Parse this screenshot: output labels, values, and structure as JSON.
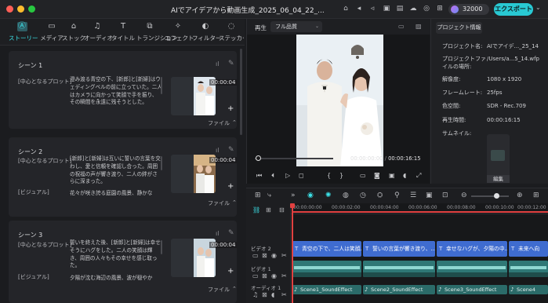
{
  "window": {
    "title": "AIでアイデアから動画生成_2025_06_04_22_..."
  },
  "header": {
    "credits": "32000",
    "export_label": "エクスポート",
    "icons": [
      "gift-icon",
      "paper-plane-icon",
      "megaphone-icon",
      "image-icon",
      "save-icon",
      "cloud-upload-icon",
      "headset-icon",
      "grid-icon"
    ]
  },
  "colors": {
    "accent": "#29c9d3",
    "text_clip": "#3f6cd0",
    "video_clip": "#2f7876",
    "playhead": "#e04040",
    "background": "#1b1c1f"
  },
  "media_toolbar": {
    "items": [
      {
        "label": "ストーリー",
        "icon": "ai-story-icon",
        "active": true
      },
      {
        "label": "メディア",
        "icon": "media-icon"
      },
      {
        "label": "ストック",
        "icon": "stock-icon"
      },
      {
        "label": "オーディオ",
        "icon": "music-note-icon"
      },
      {
        "label": "タイトル",
        "icon": "title-t-icon"
      },
      {
        "label": "トランジション",
        "icon": "transition-icon"
      },
      {
        "label": "エフェクト",
        "icon": "effect-icon"
      },
      {
        "label": "フィルター",
        "icon": "filter-icon"
      },
      {
        "label": "ステッカー",
        "icon": "sticker-icon"
      }
    ]
  },
  "scenes": [
    {
      "title": "シーン 1",
      "plot_label": "[中心となるプロット]",
      "plot_text": "澄み渡る青空の下、[新郎]と[新婦]はウェディングベルの前に立っていた。二人はカメラに向かって笑顔で手を振り、その瞬間を永遠に残そうとした。",
      "duration": "00:00:04",
      "file_label": "ファイル"
    },
    {
      "title": "シーン 2",
      "plot_label": "[中心となるプロット]",
      "plot_text": "[新郎]と[新婦]は互いに誓いの言葉を交わし、愛と信頼を確認し合った。周囲の祝福の声が響き渡り、二人の絆がさらに深まった。",
      "visual_label": "[ビジュアル]",
      "visual_text": "花々が咲き誇る庭園の風景、静かな",
      "duration": "00:00:04",
      "file_label": "ファイル"
    },
    {
      "title": "シーン 3",
      "plot_label": "[中心となるプロット]",
      "plot_text": "誓いを終えた後、[新郎]と[新婦]は幸せそうにハグをした。二人の笑顔は輝き、周囲の人々もその幸せを感じ取った。",
      "visual_label": "[ビジュアル]",
      "visual_text": "夕陽が沈む海辺の風景、波が穏やか",
      "duration": "00:00:04",
      "file_label": "ファイル"
    }
  ],
  "player": {
    "label": "再生",
    "quality": "フル品質",
    "current_time": "00:00:00:00",
    "separator": "/",
    "total_time": "00:00:16:15"
  },
  "project_info": {
    "tab": "プロジェクト情報",
    "rows": [
      {
        "label": "プロジェクト名:",
        "value": "AIでアイデ..._25_14"
      },
      {
        "label": "プロジェクトファイルの場所:",
        "value": "/Users/a...5_14.wfp"
      },
      {
        "label": "解像度:",
        "value": "1080 x 1920"
      },
      {
        "label": "フレームレート:",
        "value": "25fps"
      },
      {
        "label": "色空間:",
        "value": "SDR - Rec.709"
      },
      {
        "label": "再生時間:",
        "value": "00:00:16:15"
      },
      {
        "label": "サムネイル:",
        "value": ""
      }
    ],
    "thumbnail_edit": "編集"
  },
  "timeline": {
    "ruler": [
      "00:00:00:00",
      "00:00:02:00",
      "00:00:04:00",
      "00:00:06:00",
      "00:00:08:00",
      "00:00:10:00",
      "00:00:12:00"
    ],
    "tracks": {
      "video2_label": "ビデオ 2",
      "video1_label": "ビデオ 1",
      "audio1_label": "オーディオ 1"
    },
    "text_clips": [
      "青空の下で、二人は笑顔...",
      "誓いの言葉が響き渡り、...",
      "幸せなハグが、夕陽の中...",
      "未来へ向"
    ],
    "audio_clips": [
      "Scene1_SoundEffect",
      "Scene2_SoundEffect",
      "Scene3_SoundEffect",
      "Scene4"
    ]
  }
}
